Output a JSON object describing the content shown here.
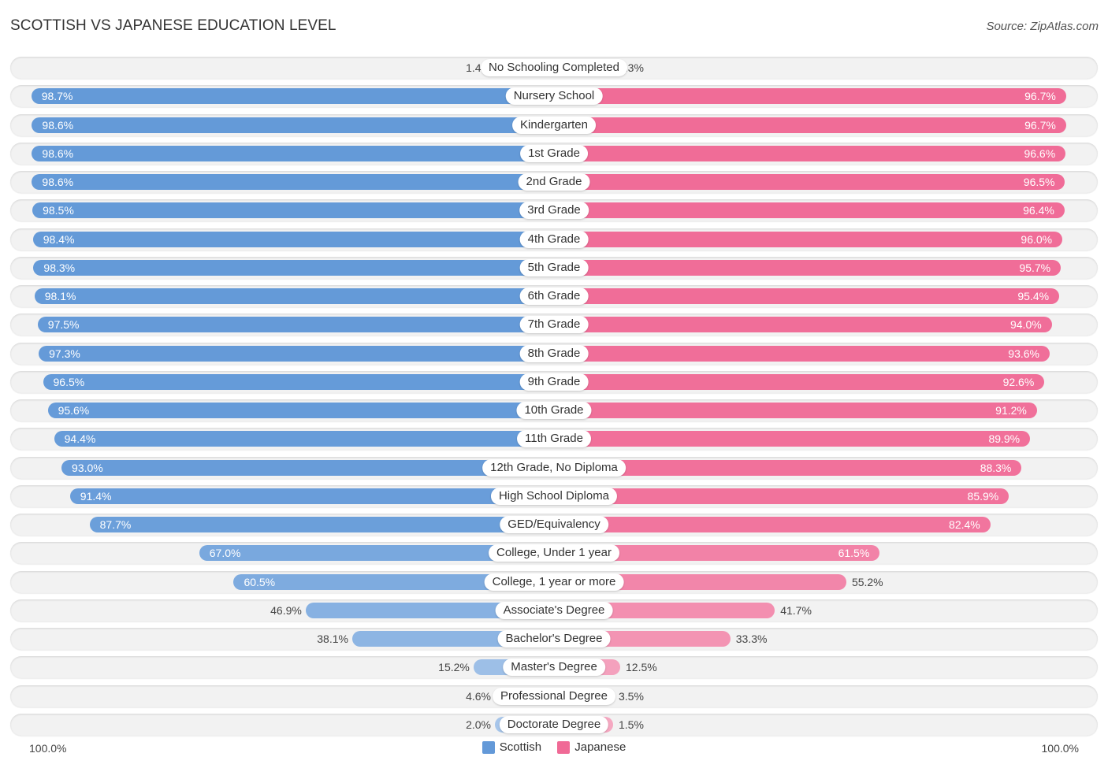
{
  "title": "SCOTTISH VS JAPANESE EDUCATION LEVEL",
  "source": "Source: ZipAtlas.com",
  "colors": {
    "scottish": "#6399d8",
    "scottish_light": "#a7c6ea",
    "japanese": "#f06a96",
    "japanese_light": "#f5a9c2"
  },
  "chart_data": {
    "type": "bar",
    "orientation": "horizontal-diverging",
    "title": "SCOTTISH VS JAPANESE EDUCATION LEVEL",
    "xlabel": "",
    "ylabel": "",
    "xlim": [
      0,
      100
    ],
    "axis_left_label": "100.0%",
    "axis_right_label": "100.0%",
    "legend": [
      "Scottish",
      "Japanese"
    ],
    "legend_position": "bottom-center",
    "categories": [
      "No Schooling Completed",
      "Nursery School",
      "Kindergarten",
      "1st Grade",
      "2nd Grade",
      "3rd Grade",
      "4th Grade",
      "5th Grade",
      "6th Grade",
      "7th Grade",
      "8th Grade",
      "9th Grade",
      "10th Grade",
      "11th Grade",
      "12th Grade, No Diploma",
      "High School Diploma",
      "GED/Equivalency",
      "College, Under 1 year",
      "College, 1 year or more",
      "Associate's Degree",
      "Bachelor's Degree",
      "Master's Degree",
      "Professional Degree",
      "Doctorate Degree"
    ],
    "series": [
      {
        "name": "Scottish",
        "values": [
          1.4,
          98.7,
          98.6,
          98.6,
          98.6,
          98.5,
          98.4,
          98.3,
          98.1,
          97.5,
          97.3,
          96.5,
          95.6,
          94.4,
          93.0,
          91.4,
          87.7,
          67.0,
          60.5,
          46.9,
          38.1,
          15.2,
          4.6,
          2.0
        ],
        "labels": [
          "1.4%",
          "98.7%",
          "98.6%",
          "98.6%",
          "98.6%",
          "98.5%",
          "98.4%",
          "98.3%",
          "98.1%",
          "97.5%",
          "97.3%",
          "96.5%",
          "95.6%",
          "94.4%",
          "93.0%",
          "91.4%",
          "87.7%",
          "67.0%",
          "60.5%",
          "46.9%",
          "38.1%",
          "15.2%",
          "4.6%",
          "2.0%"
        ]
      },
      {
        "name": "Japanese",
        "values": [
          3.3,
          96.7,
          96.7,
          96.6,
          96.5,
          96.4,
          96.0,
          95.7,
          95.4,
          94.0,
          93.6,
          92.6,
          91.2,
          89.9,
          88.3,
          85.9,
          82.4,
          61.5,
          55.2,
          41.7,
          33.3,
          12.5,
          3.5,
          1.5
        ],
        "labels": [
          "3.3%",
          "96.7%",
          "96.7%",
          "96.6%",
          "96.5%",
          "96.4%",
          "96.0%",
          "95.7%",
          "95.4%",
          "94.0%",
          "93.6%",
          "92.6%",
          "91.2%",
          "89.9%",
          "88.3%",
          "85.9%",
          "82.4%",
          "61.5%",
          "55.2%",
          "41.7%",
          "33.3%",
          "12.5%",
          "3.5%",
          "1.5%"
        ]
      }
    ]
  }
}
